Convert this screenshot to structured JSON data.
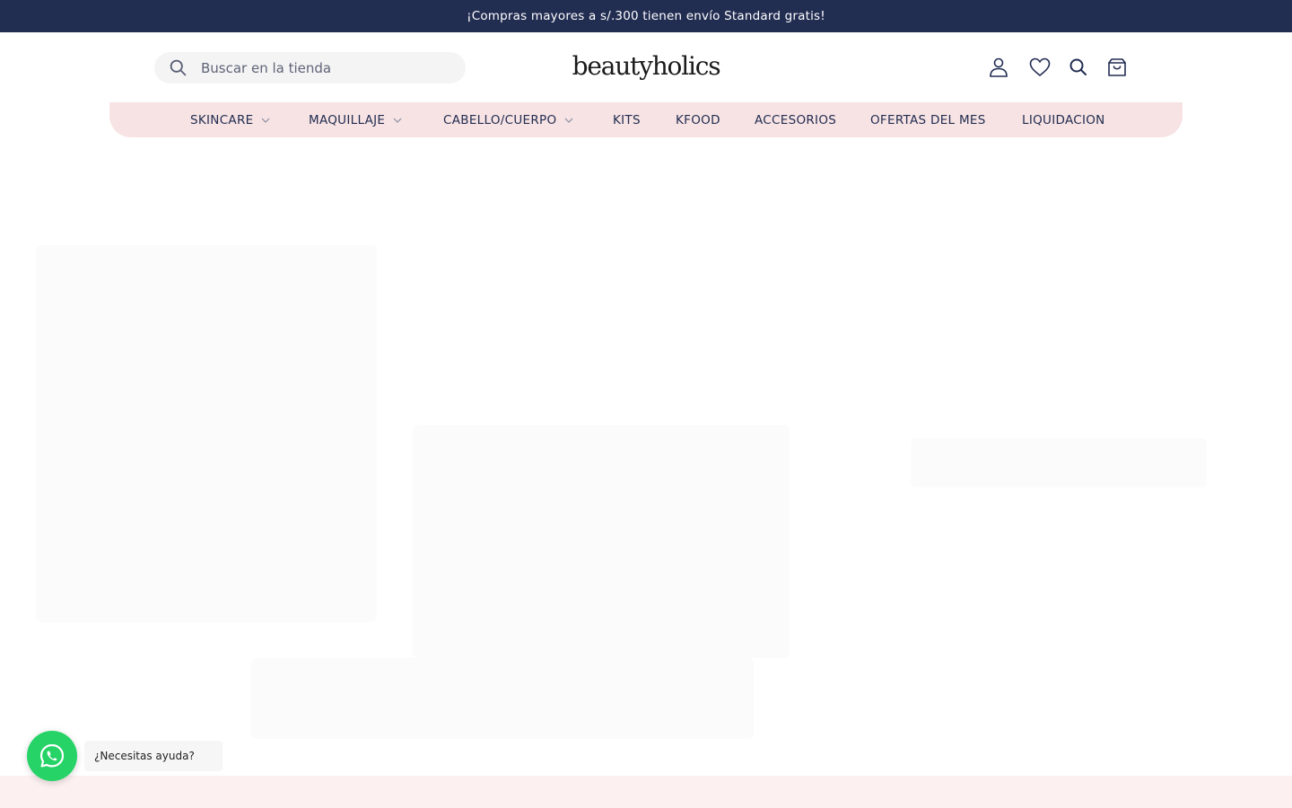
{
  "announcement": "¡Compras mayores a s/.300 tienen envío Standard gratis!",
  "search": {
    "placeholder": "Buscar en la tienda",
    "icon": "search-icon"
  },
  "logo": "beautyholics",
  "header_icons": [
    {
      "name": "account-icon"
    },
    {
      "name": "wishlist-heart-icon"
    },
    {
      "name": "search-icon"
    },
    {
      "name": "cart-icon"
    }
  ],
  "nav": {
    "items": [
      {
        "label": "SKINCARE",
        "has_dropdown": true
      },
      {
        "label": "MAQUILLAJE",
        "has_dropdown": true
      },
      {
        "label": "CABELLO/CUERPO",
        "has_dropdown": true
      },
      {
        "label": "KITS",
        "has_dropdown": false
      },
      {
        "label": "KFOOD",
        "has_dropdown": false
      },
      {
        "label": "ACCESORIOS",
        "has_dropdown": false
      },
      {
        "label": "OFERTAS DEL MES",
        "has_dropdown": false
      },
      {
        "label": "LIQUIDACION",
        "has_dropdown": false
      }
    ]
  },
  "whatsapp": {
    "label": "¿Necesitas ayuda?",
    "icon": "whatsapp-icon"
  },
  "colors": {
    "announcement_bg": "#222d52",
    "nav_bg": "#f7e3e3",
    "footer_strip_bg": "#fcf1f0",
    "whatsapp_green": "#25d366",
    "text_navy": "#222d52"
  }
}
